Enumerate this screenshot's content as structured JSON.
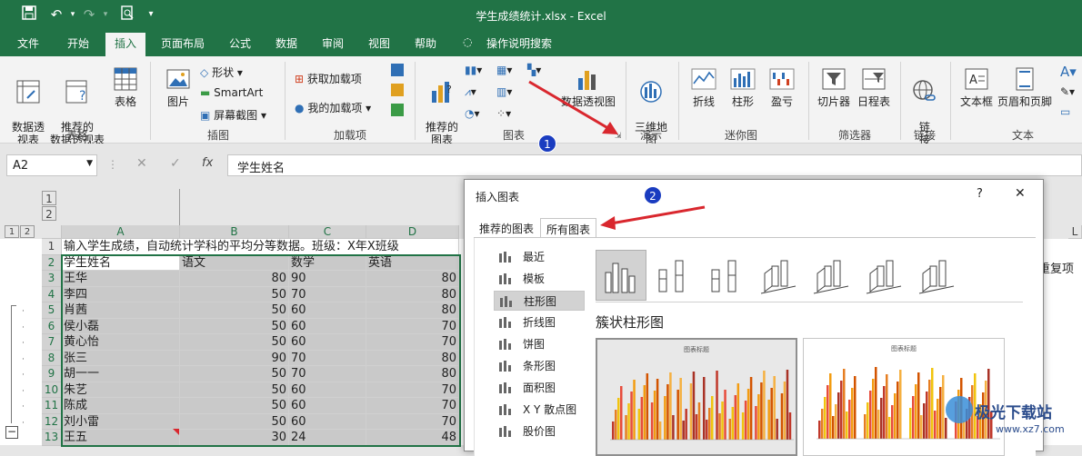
{
  "window": {
    "title": "学生成绩统计.xlsx  -  Excel"
  },
  "qat": {
    "save_icon": "save-icon",
    "undo_icon": "undo-icon",
    "redo_icon": "redo-icon",
    "preview_icon": "print-preview-icon"
  },
  "tabs": [
    "文件",
    "开始",
    "插入",
    "页面布局",
    "公式",
    "数据",
    "审阅",
    "视图",
    "帮助",
    "操作说明搜索"
  ],
  "active_tab": "插入",
  "ribbon": {
    "groups": {
      "tables": "表格",
      "illustrations": "插图",
      "addins": "加载项",
      "charts": "图表",
      "tours": "演示",
      "sparklines": "迷你图",
      "filters": "筛选器",
      "links": "链接",
      "text": "文本"
    },
    "pivot": "数据透\n视表",
    "recommended_pivot": "推荐的\n数据透视表",
    "table": "表格",
    "picture": "图片",
    "shapes": "形状",
    "smartart": "SmartArt",
    "screenshot": "屏幕截图",
    "get_addins": "获取加载项",
    "my_addins": "我的加载项",
    "recommended_charts": "推荐的\n图表",
    "pivot_chart": "数据透视图",
    "map3d": "三维地\n图",
    "line": "折线",
    "column": "柱形",
    "winloss": "盈亏",
    "slicer": "切片器",
    "timeline": "日程表",
    "link": "链\n接",
    "textbox": "文本框",
    "header_footer": "页眉和页脚"
  },
  "formula_bar": {
    "name_box": "A2",
    "fx": "fx",
    "content": "学生姓名"
  },
  "columns": [
    "A",
    "B",
    "C",
    "D"
  ],
  "outline_levels": [
    "1",
    "2"
  ],
  "rows": [
    {
      "n": "1",
      "a": "输入学生成绩，自动统计学科的平均分等数据。班级：X年X班级",
      "b": "",
      "c": "",
      "d": ""
    },
    {
      "n": "2",
      "a": "学生姓名",
      "b": "语文",
      "c": "数学",
      "d": "英语"
    },
    {
      "n": "3",
      "a": "王华",
      "b": "80",
      "c": "90",
      "d": "80"
    },
    {
      "n": "4",
      "a": "李四",
      "b": "50",
      "c": "70",
      "d": "80"
    },
    {
      "n": "5",
      "a": "肖茜",
      "b": "50",
      "c": "60",
      "d": "80"
    },
    {
      "n": "6",
      "a": "侯小磊",
      "b": "50",
      "c": "60",
      "d": "70"
    },
    {
      "n": "7",
      "a": "黄心怡",
      "b": "50",
      "c": "60",
      "d": "70"
    },
    {
      "n": "8",
      "a": "张三",
      "b": "90",
      "c": "70",
      "d": "80"
    },
    {
      "n": "9",
      "a": "胡一一",
      "b": "50",
      "c": "70",
      "d": "80"
    },
    {
      "n": "10",
      "a": "朱艺",
      "b": "50",
      "c": "60",
      "d": "70"
    },
    {
      "n": "11",
      "a": "陈成",
      "b": "50",
      "c": "60",
      "d": "70"
    },
    {
      "n": "12",
      "a": "刘小雷",
      "b": "50",
      "c": "60",
      "d": "70"
    },
    {
      "n": "13",
      "a": "王五",
      "b": "30",
      "c": "24",
      "d": "48"
    }
  ],
  "right_partial": {
    "col": "L",
    "text": "重复项"
  },
  "dialog": {
    "title": "插入图表",
    "help": "?",
    "close": "✕",
    "tabs": [
      "推荐的图表",
      "所有图表"
    ],
    "active_tab": "所有图表",
    "categories": [
      {
        "label": "最近",
        "icon": "recent-icon"
      },
      {
        "label": "模板",
        "icon": "folder-icon"
      },
      {
        "label": "柱形图",
        "icon": "column-chart-icon"
      },
      {
        "label": "折线图",
        "icon": "line-chart-icon"
      },
      {
        "label": "饼图",
        "icon": "pie-chart-icon"
      },
      {
        "label": "条形图",
        "icon": "bar-chart-icon"
      },
      {
        "label": "面积图",
        "icon": "area-chart-icon"
      },
      {
        "label": "X Y 散点图",
        "icon": "scatter-chart-icon"
      },
      {
        "label": "股价图",
        "icon": "stock-chart-icon"
      }
    ],
    "active_category": "柱形图",
    "subtype_heading": "簇状柱形图",
    "preview_title": "图表标题"
  },
  "annotations": {
    "step1": "1",
    "step2": "2"
  },
  "watermark": {
    "text": "极光下载站",
    "url": "www.xz7.com"
  },
  "colors": {
    "excel_green": "#217346",
    "arrow_red": "#d9272e",
    "badge_blue": "#1a3cc0"
  }
}
